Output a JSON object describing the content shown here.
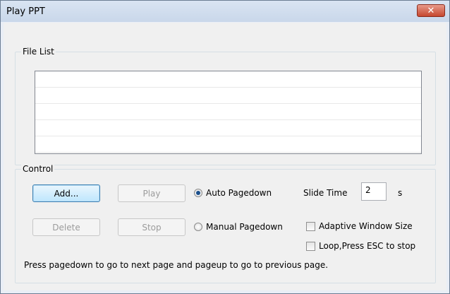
{
  "window": {
    "title": "Play PPT",
    "close_symbol": "✕"
  },
  "file_list": {
    "label": "File List",
    "rows": [
      "",
      "",
      "",
      "",
      ""
    ]
  },
  "control": {
    "label": "Control",
    "add_label": "Add...",
    "play_label": "Play",
    "delete_label": "Delete",
    "stop_label": "Stop",
    "auto_pagedown_label": "Auto Pagedown",
    "auto_pagedown_selected": true,
    "manual_pagedown_label": "Manual Pagedown",
    "slide_time_label": "Slide Time",
    "slide_time_value": "2",
    "slide_time_unit": "s",
    "adaptive_window_label": "Adaptive Window Size",
    "loop_label": "Loop,Press ESC to stop",
    "hint": "Press pagedown to go to next page and pageup to go to previous page."
  }
}
